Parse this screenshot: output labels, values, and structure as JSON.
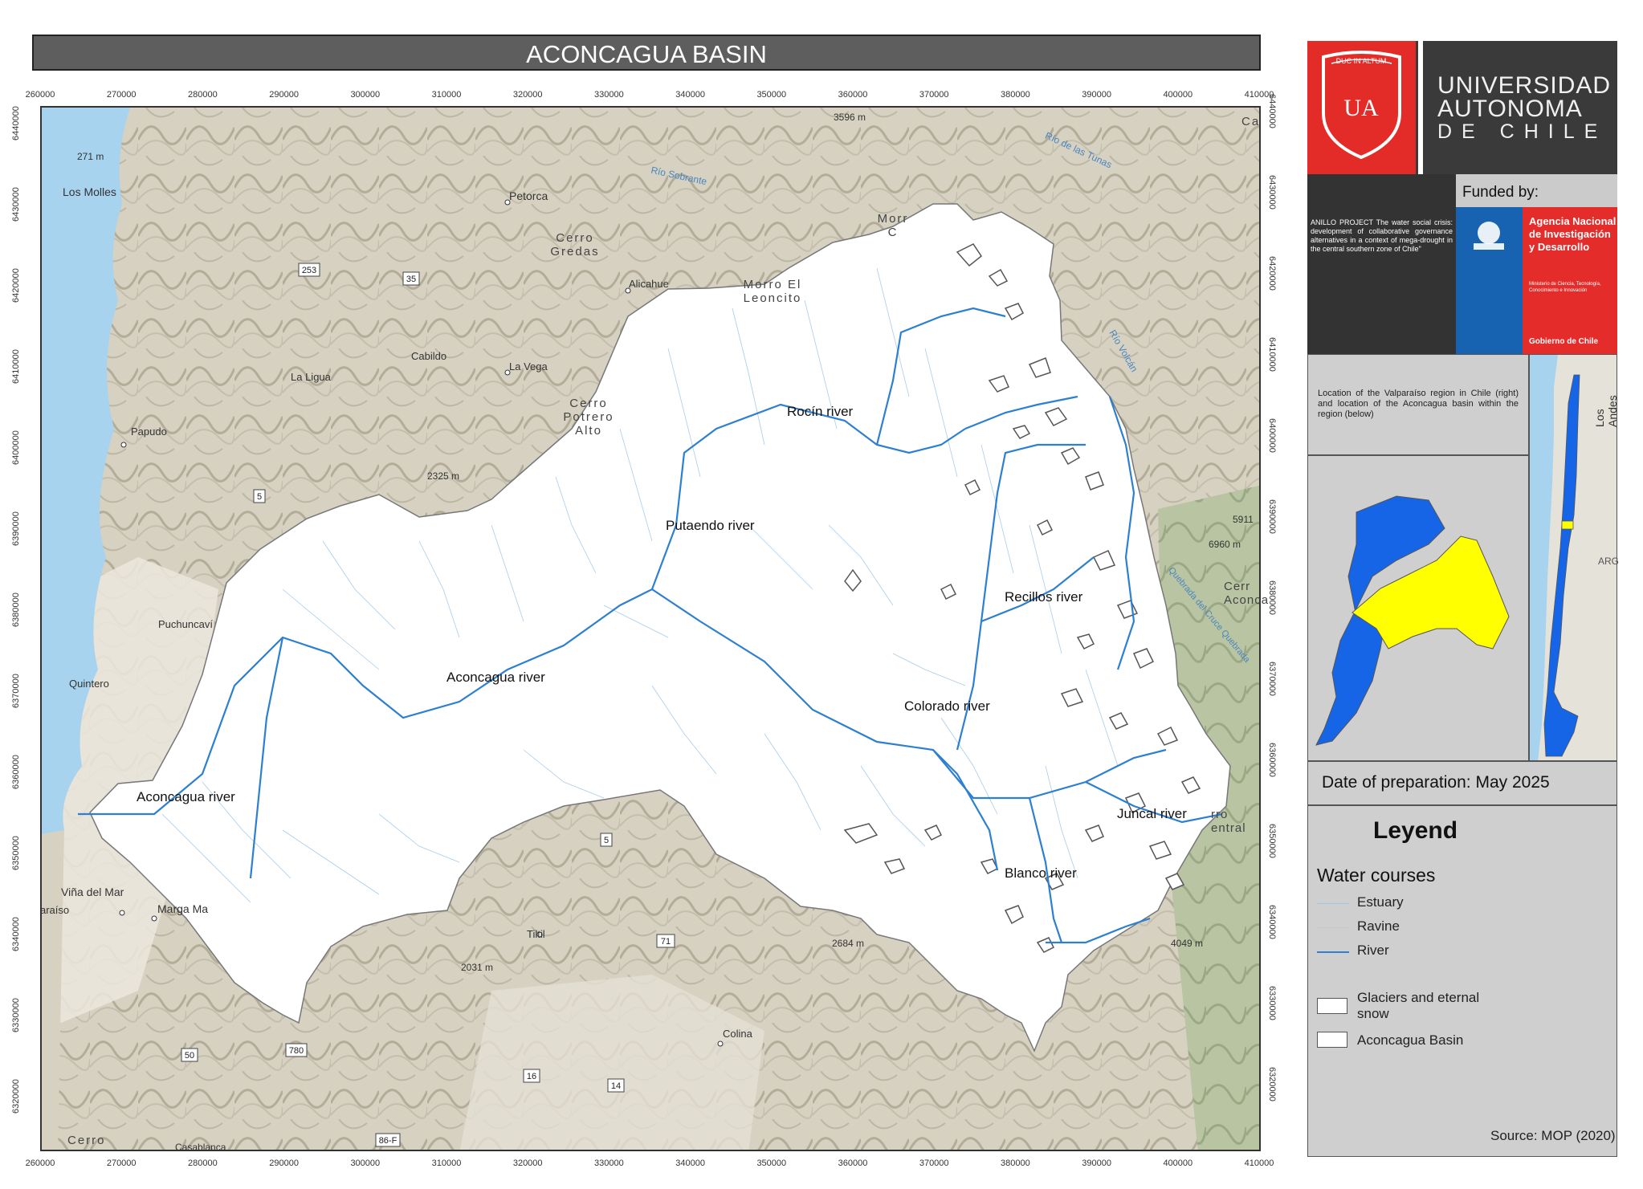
{
  "title": "ACONCAGUA BASIN",
  "axes": {
    "x_ticks": [
      "260000",
      "270000",
      "280000",
      "290000",
      "300000",
      "310000",
      "320000",
      "330000",
      "340000",
      "350000",
      "360000",
      "370000",
      "380000",
      "390000",
      "400000",
      "410000"
    ],
    "y_ticks": [
      "6440000",
      "6430000",
      "6420000",
      "6410000",
      "6400000",
      "6390000",
      "6380000",
      "6370000",
      "6360000",
      "6350000",
      "6340000",
      "6330000",
      "6320000"
    ]
  },
  "map": {
    "river_labels": {
      "rocin": "Rocín river",
      "putaendo": "Putaendo river",
      "recillos": "Recillos river",
      "aconcagua_mid": "Aconcagua river",
      "colorado": "Colorado river",
      "aconcagua_west": "Aconcagua river",
      "juncal": "Juncal river",
      "blanco": "Blanco river"
    },
    "places": {
      "los_molles": "Los Molles",
      "elev_271": "271 m",
      "petorca": "Petorca",
      "cerro_gredas": "Cerro Gredas",
      "alicahue": "Alicahue",
      "morro_leoncito": "Morro El Leoncito",
      "cabildo": "Cabildo",
      "la_vega": "La Vega",
      "la_ligua": "La Ligua",
      "cerro_potrero_alto": "Cerro Potrero Alto",
      "papudo": "Papudo",
      "elev_2325": "2325 m",
      "puchuncavi": "Puchuncaví",
      "quintero": "Quintero",
      "vina_del_mar": "Viña del Mar",
      "paraiso": "araíso",
      "marga_marga": "Marga Ma",
      "tiltil": "Tiltil",
      "elev_2031": "2031 m",
      "elev_2684": "2684 m",
      "colina": "Colina",
      "cerro_bottom": "Cerro",
      "casablanca": "Casablanca",
      "elev_3596": "3596 m",
      "rio_sobrante": "Río Sobrante",
      "rio_de_las_tunas": "Río de las Tunas",
      "rio_volcan": "Río Volcán",
      "elev_5911": "5911",
      "elev_6960": "6960 m",
      "cerro_aconcagua": "Cerr Aconca",
      "cerro_central": "rro entral",
      "elev_4049": "4049 m",
      "morro_partial": "Morr C",
      "ca_partial": "Ca",
      "quebrada_label": "Quebrada del Cruce Quebrada"
    },
    "route_shields": [
      "253",
      "35",
      "5",
      "5",
      "71",
      "50",
      "780",
      "16",
      "14",
      "86-F"
    ]
  },
  "logo": {
    "seal_text": "DUC IN ALTUM",
    "seal_letters": "UA",
    "name_line1": "UNIVERSIDAD",
    "name_line2": "AUTONOMA",
    "name_line3": "DE CHILE"
  },
  "project": {
    "text": "ANILLO PROJECT The water social crisis: development of collaborative governance alternatives in a context of mega-drought in the central southern zone of Chile\""
  },
  "funding": {
    "label": "Funded by:",
    "agency": "Agencia Nacional de Investigación y Desarrollo",
    "ministry": "Ministerio de Ciencia, Tecnología, Conocimiento e Innovación",
    "government": "Gobierno de Chile"
  },
  "location": {
    "text": "Location of the Valparaíso region in Chile (right) and location of the Aconcagua basin within the region (below)",
    "chile_map_labels": {
      "andes": "Los Andes",
      "arg": "ARG"
    }
  },
  "date": "Date of preparation: May 2025",
  "legend": {
    "title": "Leyend",
    "subtitle": "Water courses",
    "items": [
      {
        "label": "Estuary",
        "color": "#9ec6e6"
      },
      {
        "label": "Ravine",
        "color": "#c7c7c7"
      },
      {
        "label": "River",
        "color": "#2d7fd1"
      }
    ],
    "areas": [
      {
        "label": "Glaciers and eternal snow"
      },
      {
        "label": "Aconcagua Basin"
      }
    ]
  },
  "source": "Source: MOP (2020)",
  "colors": {
    "river": "#2d7fd1",
    "basin_fill": "#ffffff",
    "region_blue": "#1565e6",
    "basin_yellow": "#ffff00",
    "ocean": "#a7d3ef",
    "relief": "#cfcab9"
  }
}
